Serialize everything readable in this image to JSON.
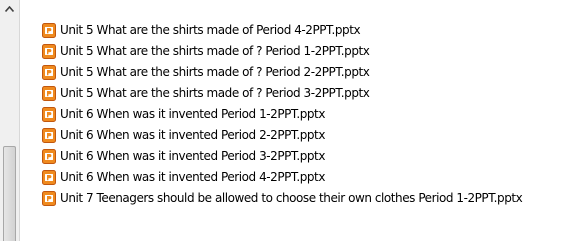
{
  "files": [
    {
      "name": "Unit 5 What are the shirts made of Period 4-2PPT.pptx",
      "icon": "powerpoint-file-icon"
    },
    {
      "name": "Unit 5 What are the shirts made of ? Period 1-2PPT.pptx",
      "icon": "powerpoint-file-icon"
    },
    {
      "name": "Unit 5 What are the shirts made of ? Period 2-2PPT.pptx",
      "icon": "powerpoint-file-icon"
    },
    {
      "name": "Unit 5 What are the shirts made of ? Period 3-2PPT.pptx",
      "icon": "powerpoint-file-icon"
    },
    {
      "name": "Unit 6 When was it invented Period 1-2PPT.pptx",
      "icon": "powerpoint-file-icon"
    },
    {
      "name": "Unit 6 When was it invented Period 2-2PPT.pptx",
      "icon": "powerpoint-file-icon"
    },
    {
      "name": "Unit 6 When was it invented Period 3-2PPT.pptx",
      "icon": "powerpoint-file-icon"
    },
    {
      "name": "Unit 6 When was it invented Period 4-2PPT.pptx",
      "icon": "powerpoint-file-icon"
    },
    {
      "name": "Unit 7 Teenagers should be allowed to choose their own clothes Period 1-2PPT.pptx",
      "icon": "powerpoint-file-icon"
    }
  ],
  "colors": {
    "pptx_icon_fill": "#ef8a1e",
    "pptx_icon_border": "#c2570e"
  }
}
